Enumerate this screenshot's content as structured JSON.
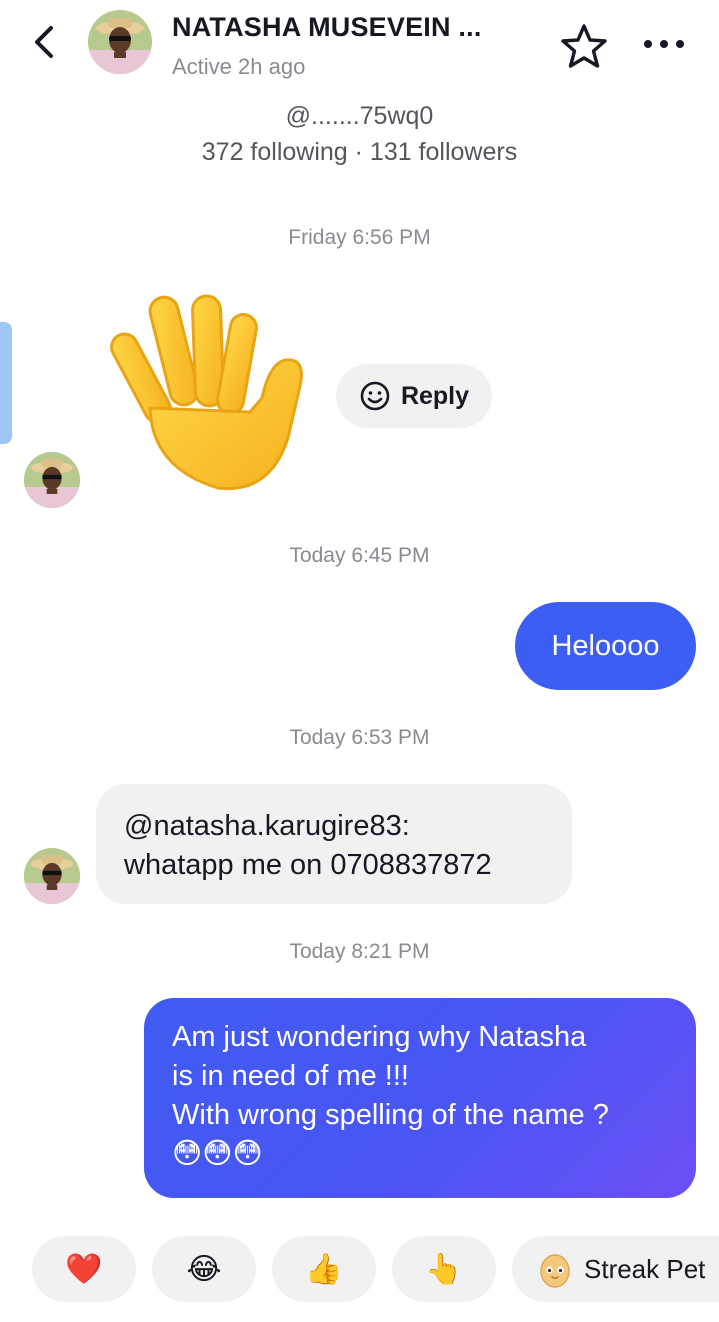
{
  "header": {
    "name": "NATASHA MUSEVEIN ...",
    "status": "Active 2h ago"
  },
  "profile": {
    "handle": "@.......75wq0",
    "counts": "372 following · 131 followers"
  },
  "conversation": {
    "ts_1": "Friday 6:56 PM",
    "reply_label": "Reply",
    "ts_2": "Today 6:45 PM",
    "msg_1": "Heloooo",
    "ts_3": "Today 6:53 PM",
    "msg_2_line_1": "@natasha.karugire83:",
    "msg_2_line_2": "whatapp me on 0708837872",
    "ts_4": "Today 8:21 PM",
    "msg_3_line_1": "Am just wondering why Natasha",
    "msg_3_line_2": "is in need of me !!!",
    "msg_3_line_3": "With wrong spelling of the name ?",
    "msg_3_line_4": "😳😳😳"
  },
  "quick_reactions": {
    "heart": "❤️",
    "laugh": "😂",
    "thumbs_up": "👍",
    "point": "👆",
    "streak_label": "Streak Pet"
  },
  "icons": {
    "back": "chevron-left-icon",
    "star": "star-outline-icon",
    "more": "ellipsis-icon",
    "reply": "smile-icon",
    "wave": "waving-hand-emoji",
    "streak": "egg-pet-icon"
  },
  "colors": {
    "outgoing_bubble": "#3c5ef5",
    "incoming_bubble": "#f1f1f2",
    "gradient_end": "#6b4ff6",
    "secondary_text": "#8a8b91"
  }
}
